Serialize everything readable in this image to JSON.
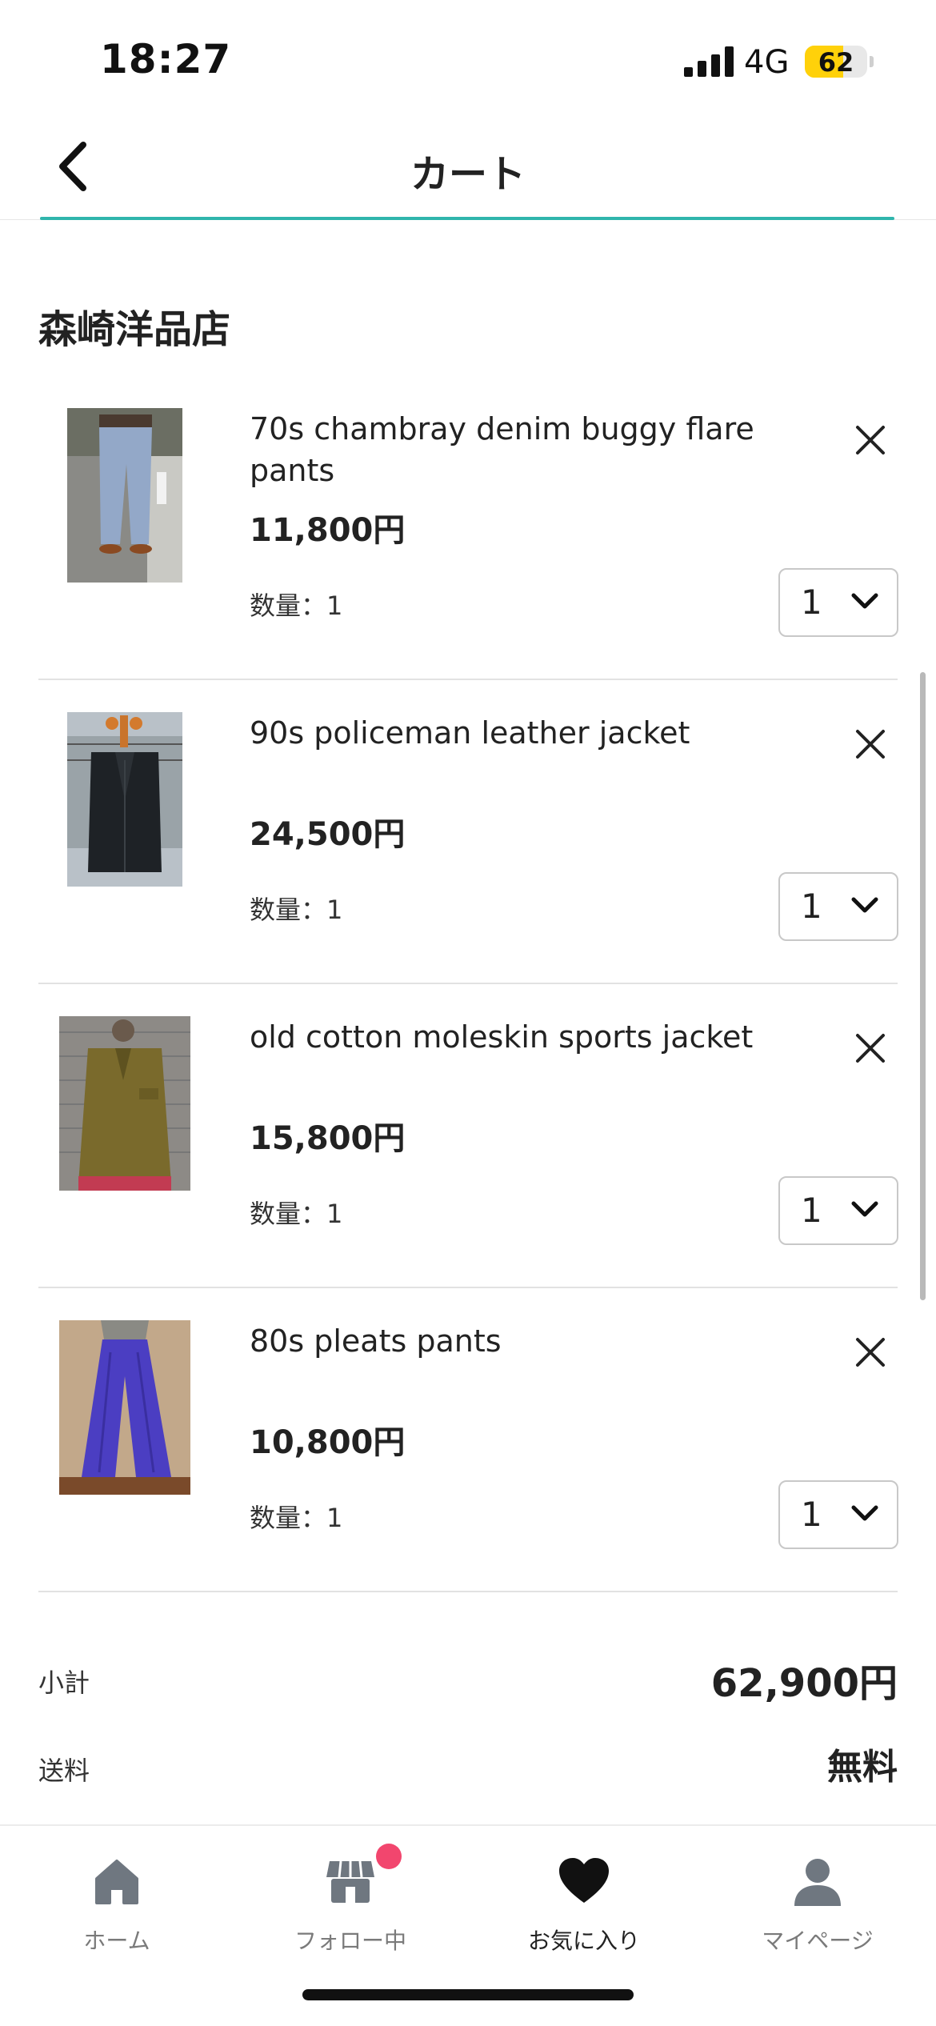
{
  "status_bar": {
    "time": "18:27",
    "network": "4G",
    "battery": "62",
    "battery_level": 0.62
  },
  "nav": {
    "title": "カート"
  },
  "shop": {
    "name": "森崎洋品店"
  },
  "items": [
    {
      "title": "70s chambray denim buggy flare pants",
      "price": "11,800円",
      "quantity_label": "数量：1",
      "quantity_value": "1"
    },
    {
      "title": "90s policeman leather jacket",
      "price": "24,500円",
      "quantity_label": "数量：1",
      "quantity_value": "1"
    },
    {
      "title": "old cotton moleskin sports jacket",
      "price": "15,800円",
      "quantity_label": "数量：1",
      "quantity_value": "1"
    },
    {
      "title": "80s  pleats pants",
      "price": "10,800円",
      "quantity_label": "数量：1",
      "quantity_value": "1"
    }
  ],
  "summary": {
    "subtotal_label": "小計",
    "subtotal_value": "62,900円",
    "shipping_label": "送料",
    "shipping_value": "無料"
  },
  "tabs": [
    {
      "label": "ホーム",
      "icon": "home-icon"
    },
    {
      "label": "フォロー中",
      "icon": "store-icon"
    },
    {
      "label": "お気に入り",
      "icon": "heart-icon"
    },
    {
      "label": "マイページ",
      "icon": "user-icon"
    }
  ],
  "colors": {
    "accent": "#2fb5ac",
    "badge": "#f2466e",
    "battery": "#ffd10a"
  }
}
